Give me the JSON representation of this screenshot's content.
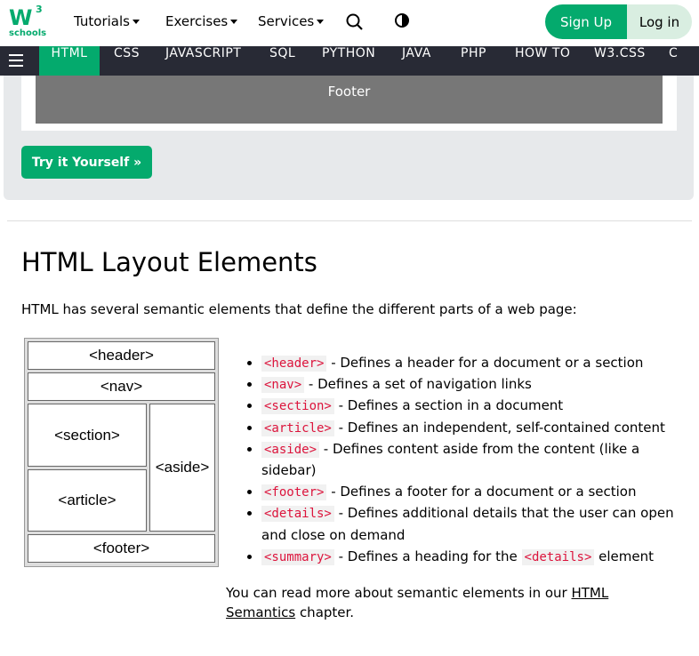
{
  "header": {
    "logo_text": "W",
    "logo_sup": "3",
    "logo_sub": "schools",
    "menus": [
      "Tutorials",
      "Exercises",
      "Services"
    ],
    "signup_label": "Sign Up",
    "login_label": "Log in"
  },
  "nav": {
    "items": [
      "HTML",
      "CSS",
      "JAVASCRIPT",
      "SQL",
      "PYTHON",
      "JAVA",
      "PHP",
      "HOW TO",
      "W3.CSS",
      "C"
    ],
    "active": "HTML"
  },
  "example": {
    "footer_label": "Footer",
    "try_button": "Try it Yourself »"
  },
  "section": {
    "title": "HTML Layout Elements",
    "intro": "HTML has several semantic elements that define the different parts of a web page:",
    "diagram": {
      "header": "<header>",
      "nav": "<nav>",
      "section": "<section>",
      "article": "<article>",
      "aside": "<aside>",
      "footer": "<footer>"
    },
    "items": [
      {
        "tag": "<header>",
        "desc": " - Defines a header for a document or a section"
      },
      {
        "tag": "<nav>",
        "desc": " - Defines a set of navigation links"
      },
      {
        "tag": "<section>",
        "desc": " - Defines a section in a document"
      },
      {
        "tag": "<article>",
        "desc": " - Defines an independent, self-contained content"
      },
      {
        "tag": "<aside>",
        "desc": " - Defines content aside from the content (like a sidebar)"
      },
      {
        "tag": "<footer>",
        "desc": " - Defines a footer for a document or a section"
      },
      {
        "tag": "<details>",
        "desc": " - Defines additional details that the user can open and close on demand"
      },
      {
        "tag": "<summary>",
        "desc": " - Defines a heading for the ",
        "tag2": "<details>",
        "desc2": " element"
      }
    ],
    "more_prefix": "You can read more about semantic elements in our ",
    "more_link": "HTML Semantics",
    "more_suffix": " chapter."
  },
  "colors": {
    "brand": "#04AA6D",
    "nav_bg": "#282A35",
    "code": "#DC143C"
  }
}
